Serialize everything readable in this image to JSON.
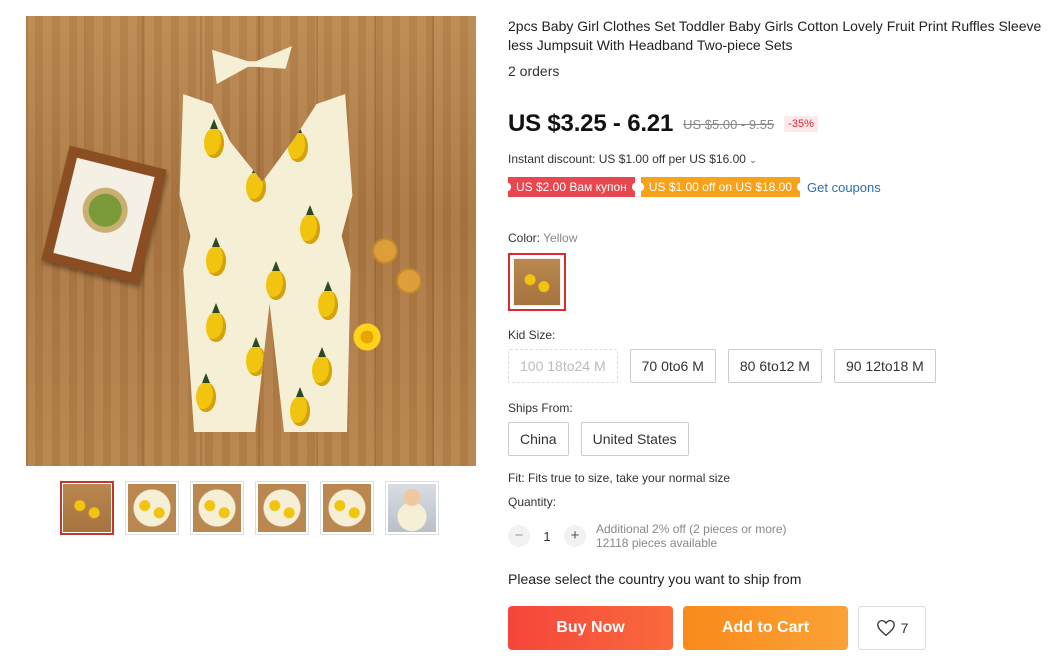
{
  "gallery": {
    "thumbnails": [
      "thumb-1",
      "thumb-2",
      "thumb-3",
      "thumb-4",
      "thumb-5",
      "thumb-6"
    ]
  },
  "product": {
    "title": "2pcs Baby Girl Clothes Set Toddler Baby Girls Cotton Lovely Fruit Print Ruffles Sleeve less Jumpsuit With Headband Two-piece Sets",
    "orders": "2 orders",
    "price": "US $3.25 - 6.21",
    "old_price": "US $5.00 - 9.55",
    "discount": "-35%",
    "instant_discount": "Instant discount: US $1.00 off per US $16.00",
    "coupons": [
      {
        "label": "US $2.00 Вам купон",
        "color": "#e8474f"
      },
      {
        "label": "US $1.00 off on US $18.00",
        "color": "#f7a21a"
      }
    ],
    "get_coupons": "Get coupons"
  },
  "color": {
    "label": "Color:",
    "selected": "Yellow"
  },
  "kid_size": {
    "label": "Kid Size:",
    "options": [
      "100 18to24 M",
      "70 0to6 M",
      "80 6to12 M",
      "90 12to18 M"
    ]
  },
  "ships_from": {
    "label": "Ships From:",
    "options": [
      "China",
      "United States"
    ]
  },
  "fit": "Fit: Fits true to size, take your normal size",
  "quantity": {
    "label": "Quantity:",
    "value": "1",
    "minus": "−",
    "plus": "+",
    "additional": "Additional 2% off (2 pieces or more)",
    "available": "12118 pieces available"
  },
  "ship_note": "Please select the country you want to ship from",
  "actions": {
    "buy_now": "Buy Now",
    "add_to_cart": "Add to Cart",
    "wishlist_count": "7"
  },
  "colors": {
    "accent_red": "#e0282e",
    "buy_gradient": "#f5453b",
    "cart_gradient": "#f98a1a",
    "link": "#2b6fb6"
  }
}
